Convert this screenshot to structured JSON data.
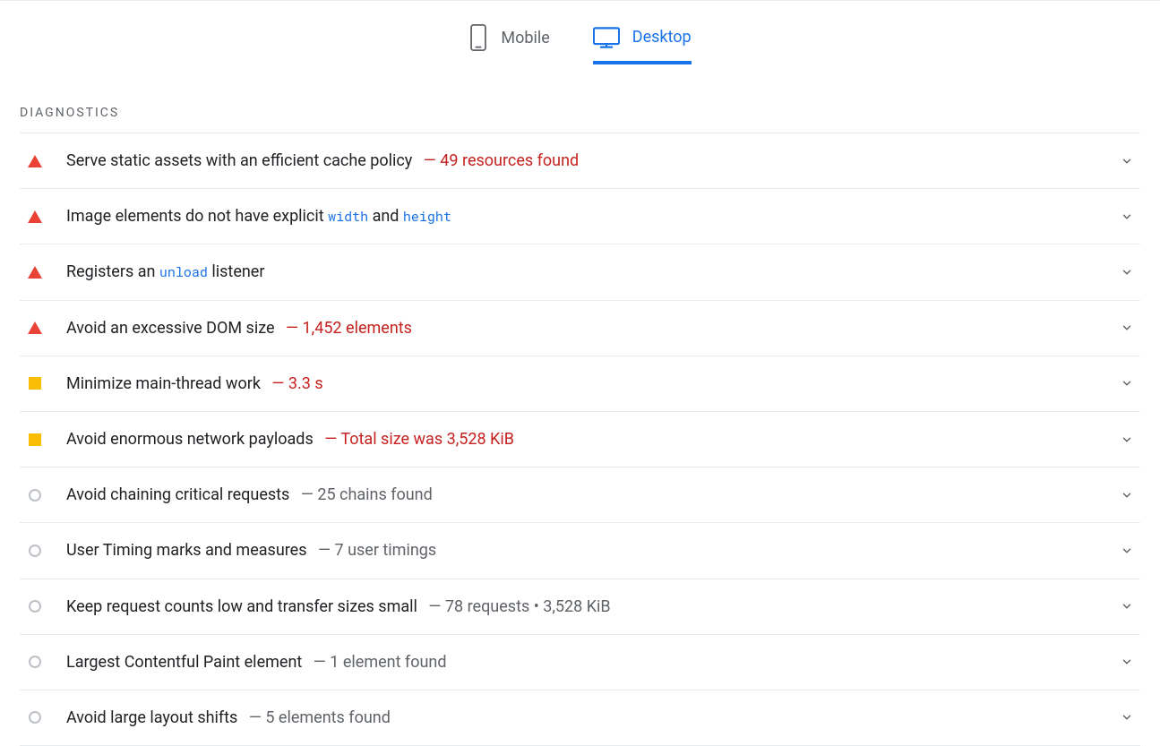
{
  "tabs": {
    "mobile": "Mobile",
    "desktop": "Desktop"
  },
  "sectionTitle": "DIAGNOSTICS",
  "audits": [
    {
      "severity": "fail",
      "title_parts": [
        {
          "t": "text",
          "v": "Serve static assets with an efficient cache policy"
        }
      ],
      "detail": "— 49 resources found",
      "detail_class": "fail"
    },
    {
      "severity": "fail",
      "title_parts": [
        {
          "t": "text",
          "v": "Image elements do not have explicit "
        },
        {
          "t": "code",
          "v": "width"
        },
        {
          "t": "text",
          "v": " and "
        },
        {
          "t": "code",
          "v": "height"
        }
      ],
      "detail": "",
      "detail_class": ""
    },
    {
      "severity": "fail",
      "title_parts": [
        {
          "t": "text",
          "v": "Registers an "
        },
        {
          "t": "code",
          "v": "unload"
        },
        {
          "t": "text",
          "v": " listener"
        }
      ],
      "detail": "",
      "detail_class": ""
    },
    {
      "severity": "fail",
      "title_parts": [
        {
          "t": "text",
          "v": "Avoid an excessive DOM size"
        }
      ],
      "detail": "— 1,452 elements",
      "detail_class": "fail"
    },
    {
      "severity": "average",
      "title_parts": [
        {
          "t": "text",
          "v": "Minimize main-thread work"
        }
      ],
      "detail": "— 3.3 s",
      "detail_class": "average"
    },
    {
      "severity": "average",
      "title_parts": [
        {
          "t": "text",
          "v": "Avoid enormous network payloads"
        }
      ],
      "detail": "— Total size was 3,528 KiB",
      "detail_class": "average"
    },
    {
      "severity": "info",
      "title_parts": [
        {
          "t": "text",
          "v": "Avoid chaining critical requests"
        }
      ],
      "detail": "— 25 chains found",
      "detail_class": "info"
    },
    {
      "severity": "info",
      "title_parts": [
        {
          "t": "text",
          "v": "User Timing marks and measures"
        }
      ],
      "detail": "— 7 user timings",
      "detail_class": "info"
    },
    {
      "severity": "info",
      "title_parts": [
        {
          "t": "text",
          "v": "Keep request counts low and transfer sizes small"
        }
      ],
      "detail": "— 78 requests • 3,528 KiB",
      "detail_class": "info"
    },
    {
      "severity": "info",
      "title_parts": [
        {
          "t": "text",
          "v": "Largest Contentful Paint element"
        }
      ],
      "detail": "— 1 element found",
      "detail_class": "info"
    },
    {
      "severity": "info",
      "title_parts": [
        {
          "t": "text",
          "v": "Avoid large layout shifts"
        }
      ],
      "detail": "— 5 elements found",
      "detail_class": "info"
    }
  ]
}
